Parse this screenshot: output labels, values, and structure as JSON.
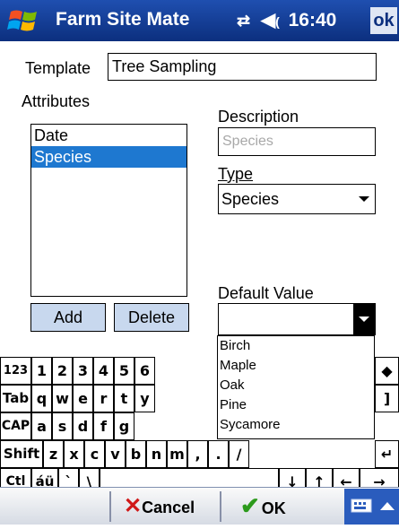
{
  "titlebar": {
    "app_title": "Farm Site Mate",
    "time": "16:40",
    "ok_label": "ok"
  },
  "form": {
    "template_label": "Template",
    "template_value": "Tree Sampling",
    "attributes_label": "Attributes",
    "attributes": [
      "Date",
      "Species"
    ],
    "selected_attribute": "Species",
    "description_label": "Description",
    "description_placeholder": "Species",
    "type_label": "Type",
    "type_value": "Species",
    "default_value_label": "Default Value",
    "default_value": "",
    "default_value_options": [
      "Birch",
      "Maple",
      "Oak",
      "Pine",
      "Sycamore"
    ],
    "add_label": "Add",
    "delete_label": "Delete"
  },
  "keyboard": {
    "row1": [
      "123",
      "1",
      "2",
      "3",
      "4",
      "5",
      "6"
    ],
    "row2": [
      "Tab",
      "q",
      "w",
      "e",
      "r",
      "t",
      "y"
    ],
    "row3": [
      "CAP",
      "a",
      "s",
      "d",
      "f",
      "g"
    ],
    "row4": [
      "Shift",
      "z",
      "x",
      "c",
      "v",
      "b",
      "n",
      "m",
      ",",
      ".",
      "/"
    ],
    "row5": [
      "Ctl",
      "áü",
      "`",
      "\\",
      "↓",
      "↑",
      "←",
      "→"
    ],
    "right_keys": [
      "◆",
      "]",
      "↵"
    ]
  },
  "softkeys": {
    "cancel_label": "Cancel",
    "ok_label": "OK"
  },
  "colors": {
    "titlebar": "#0c2f7e",
    "selection": "#1e78d0",
    "button_face": "#c8d8ee",
    "ok_check": "#2c9a1c",
    "cancel_x": "#d01818"
  }
}
